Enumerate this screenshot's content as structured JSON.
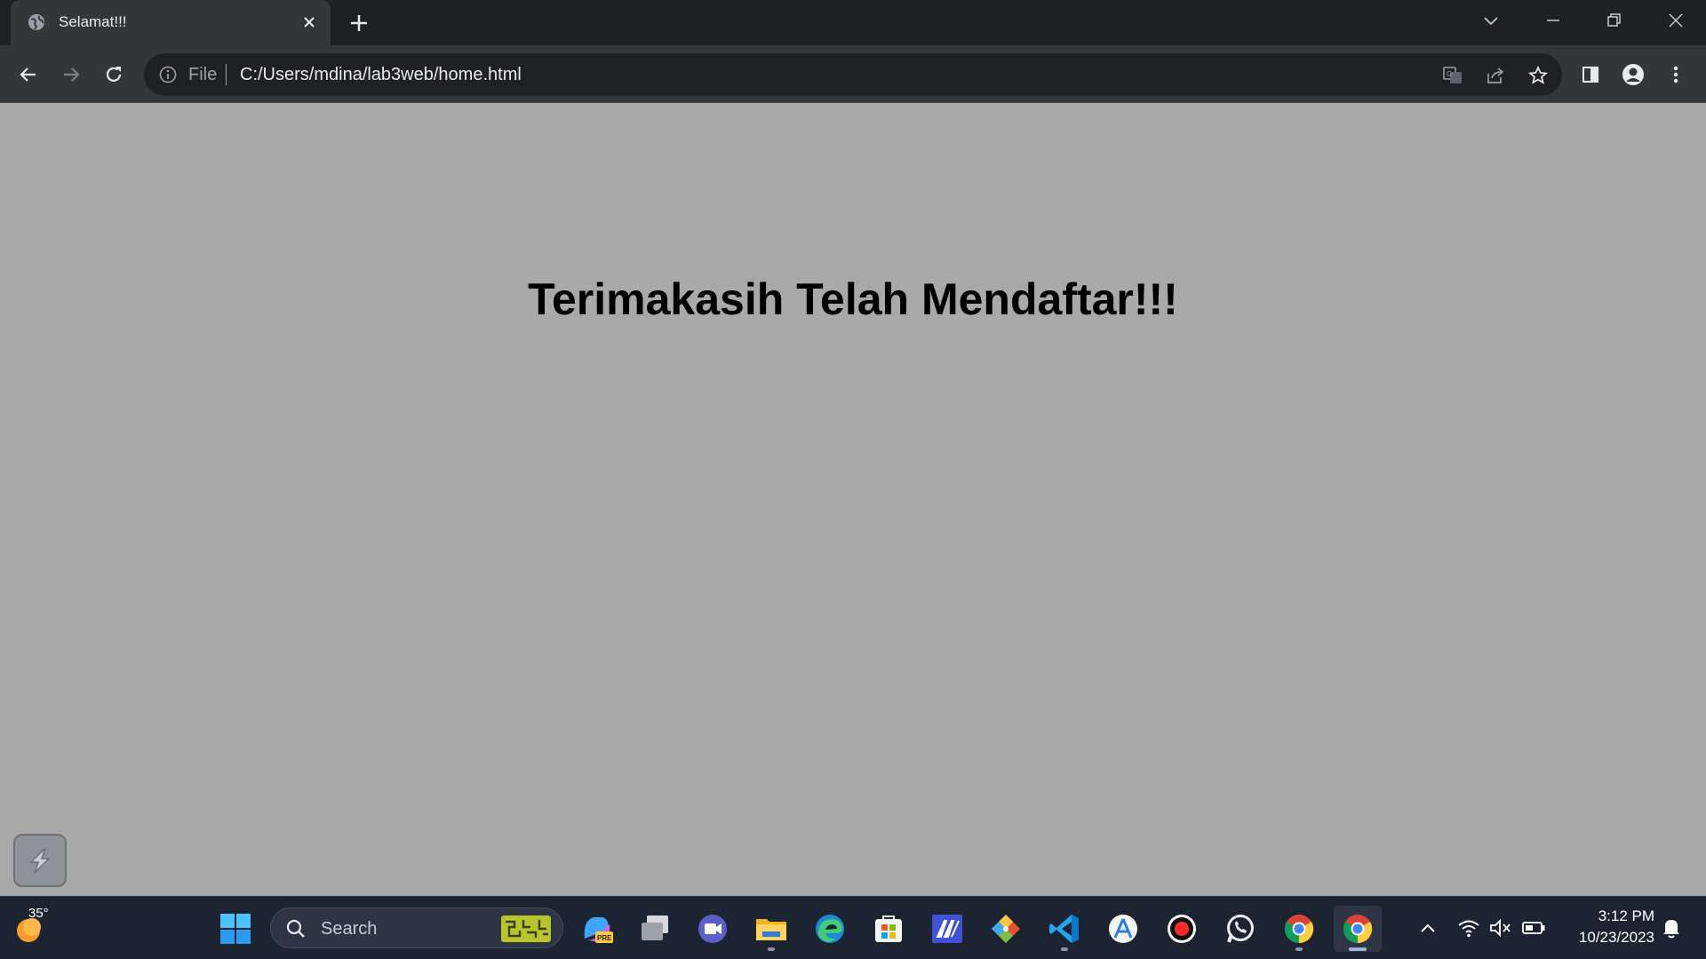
{
  "browser": {
    "tab_title": "Selamat!!!",
    "address_scheme": "File",
    "address_url": "C:/Users/mdina/lab3web/home.html"
  },
  "page": {
    "heading": "Terimakasih Telah Mendaftar!!!"
  },
  "taskbar": {
    "weather_temp": "35°",
    "search_placeholder": "Search",
    "clock_time": "3:12 PM",
    "clock_date": "10/23/2023",
    "apps": [
      "copilot-pre-icon",
      "task-view-icon",
      "meet-icon",
      "file-explorer-icon",
      "edge-icon",
      "store-icon",
      "visual-studio-icon",
      "git-icon",
      "vscode-icon",
      "app-icon",
      "record-icon",
      "whatsapp-icon",
      "chrome-icon",
      "chrome-icon"
    ]
  },
  "colors": {
    "page_background": "#a9a9a9",
    "browser_frame": "#1f2023",
    "toolbar": "#35363a",
    "taskbar": "#1c2331"
  }
}
